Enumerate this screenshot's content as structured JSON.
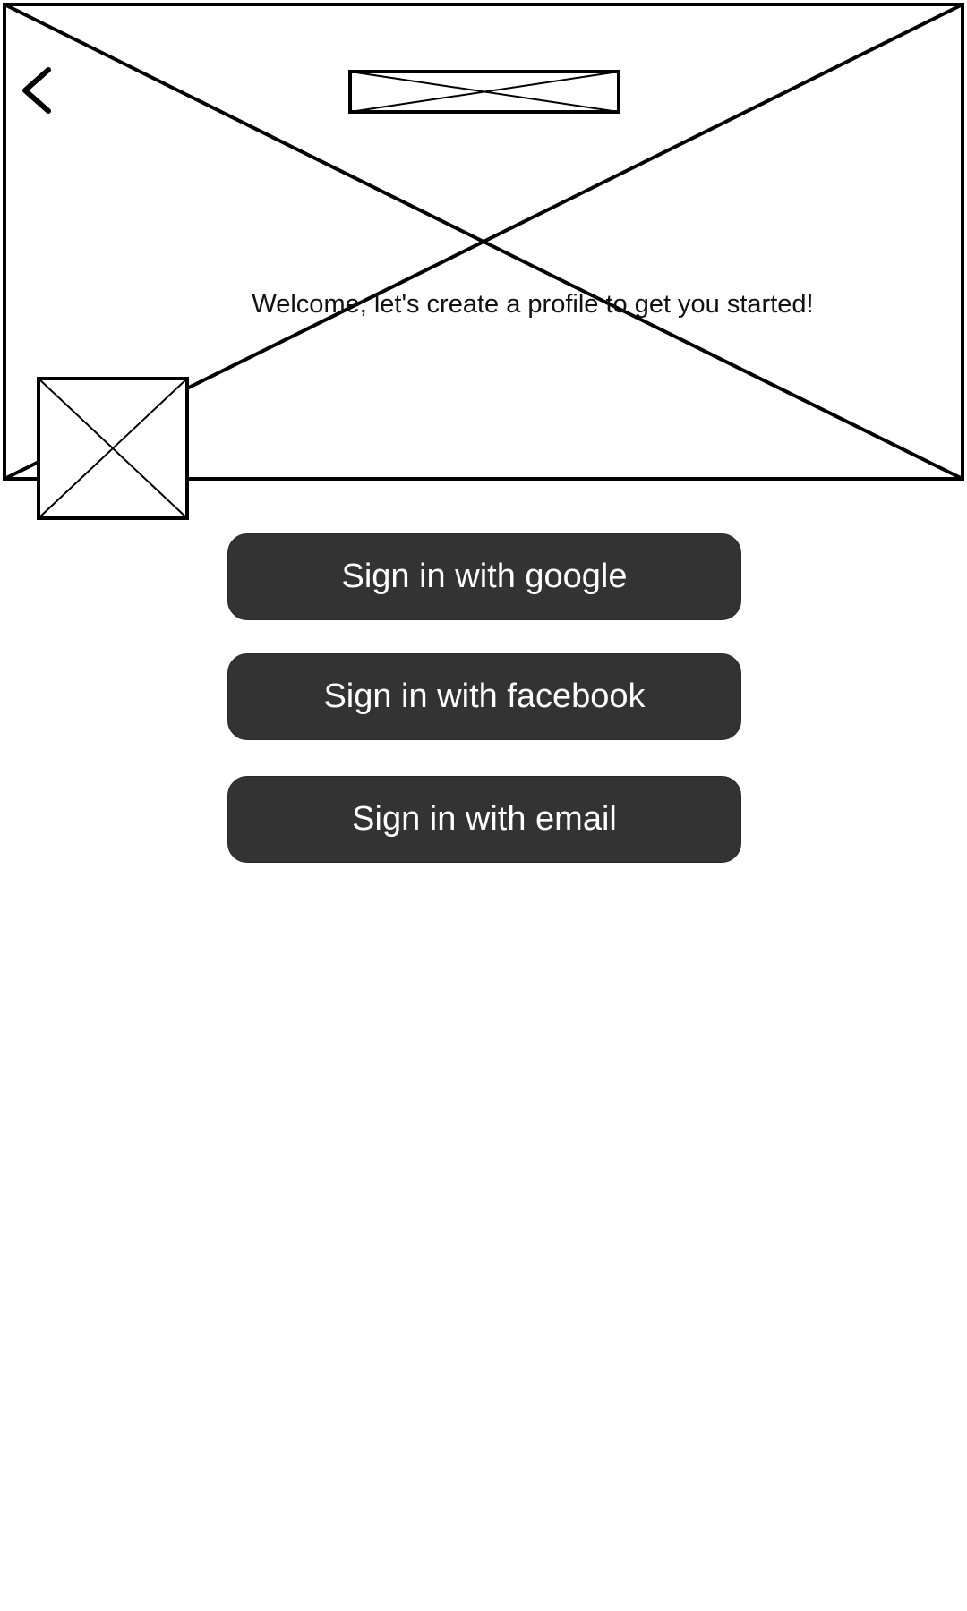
{
  "header": {
    "back_icon": "chevron-left-icon",
    "hero_image": "image-placeholder",
    "logo_image": "image-placeholder"
  },
  "welcome": {
    "text": "Welcome, let's create a profile to get you started!"
  },
  "avatar": {
    "image": "image-placeholder"
  },
  "auth": {
    "google_label": "Sign in with google",
    "facebook_label": "Sign in with facebook",
    "email_label": "Sign in with email"
  },
  "colors": {
    "button_bg": "#333333",
    "button_text": "#ffffff",
    "stroke": "#000000",
    "background": "#ffffff"
  }
}
